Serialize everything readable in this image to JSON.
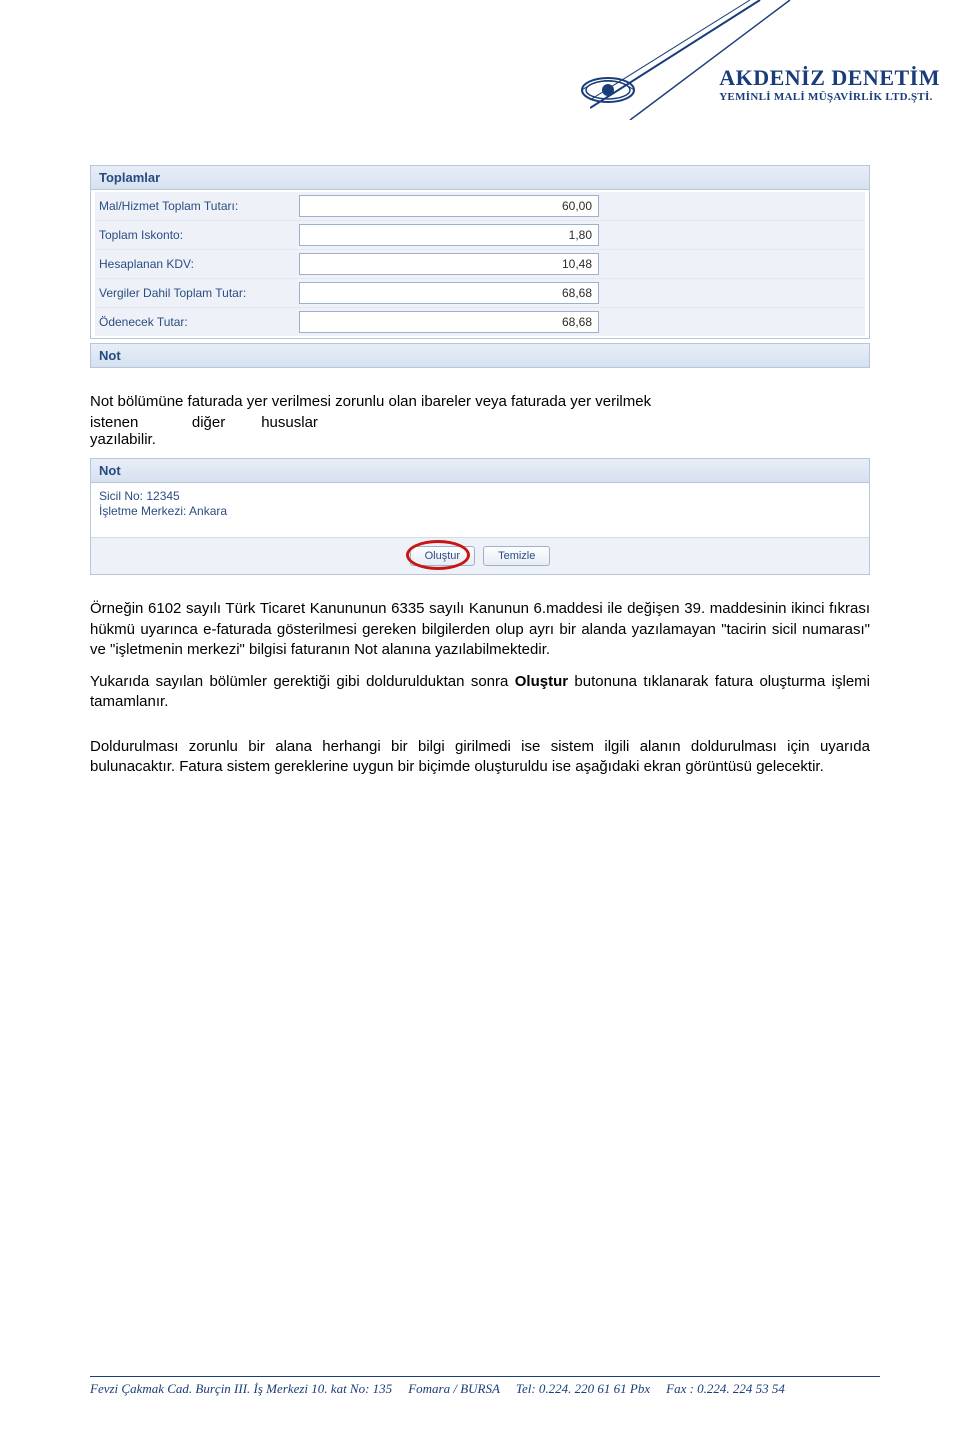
{
  "header": {
    "title": "AKDENİZ DENETİM",
    "subtitle": "YEMİNLİ MALİ MÜŞAVİRLİK LTD.ŞTİ."
  },
  "totals_panel": {
    "title": "Toplamlar",
    "rows": [
      {
        "label": "Mal/Hizmet Toplam Tutarı:",
        "value": "60,00"
      },
      {
        "label": "Toplam Iskonto:",
        "value": "1,80"
      },
      {
        "label": "Hesaplanan KDV:",
        "value": "10,48"
      },
      {
        "label": "Vergiler Dahil Toplam Tutar:",
        "value": "68,68"
      },
      {
        "label": "Ödenecek Tutar:",
        "value": "68,68"
      }
    ]
  },
  "not_panel1": {
    "title": "Not"
  },
  "para1_line1": "Not bölümüne faturada yer verilmesi zorunlu olan ibareler veya faturada yer verilmek",
  "para1_wrap": {
    "left1": "istenen",
    "left2": "yazılabilir.",
    "mid": "diğer",
    "right": "hususlar"
  },
  "note_panel": {
    "title": "Not",
    "line1": "Sicil No: 12345",
    "line2": "İşletme Merkezi: Ankara"
  },
  "buttons": {
    "create": "Oluştur",
    "clear": "Temizle"
  },
  "para2": "Örneğin 6102 sayılı Türk Ticaret Kanununun 6335 sayılı Kanunun 6.maddesi ile değişen 39. maddesinin ikinci fıkrası hükmü uyarınca e-faturada gösterilmesi gereken bilgilerden olup ayrı bir alanda yazılamayan \"tacirin sicil numarası\" ve \"işletmenin merkezi\" bilgisi faturanın Not alanına yazılabilmektedir.",
  "para3_a": "Yukarıda sayılan bölümler gerektiği gibi doldurulduktan sonra ",
  "para3_bold": "Oluştur",
  "para3_b": " butonuna tıklanarak fatura oluşturma işlemi tamamlanır.",
  "para4": "Doldurulması zorunlu bir alana herhangi bir bilgi girilmedi ise sistem ilgili alanın doldurulması için uyarıda bulunacaktır. Fatura sistem gereklerine uygun bir biçimde oluşturuldu ise aşağıdaki ekran görüntüsü gelecektir.",
  "footer": {
    "addr": "Fevzi Çakmak Cad. Burçin III. İş Merkezi 10. kat No: 135",
    "city": "Fomara / BURSA",
    "tel": "Tel: 0.224. 220 61 61 Pbx",
    "fax": "Fax : 0.224. 224 53 54"
  }
}
